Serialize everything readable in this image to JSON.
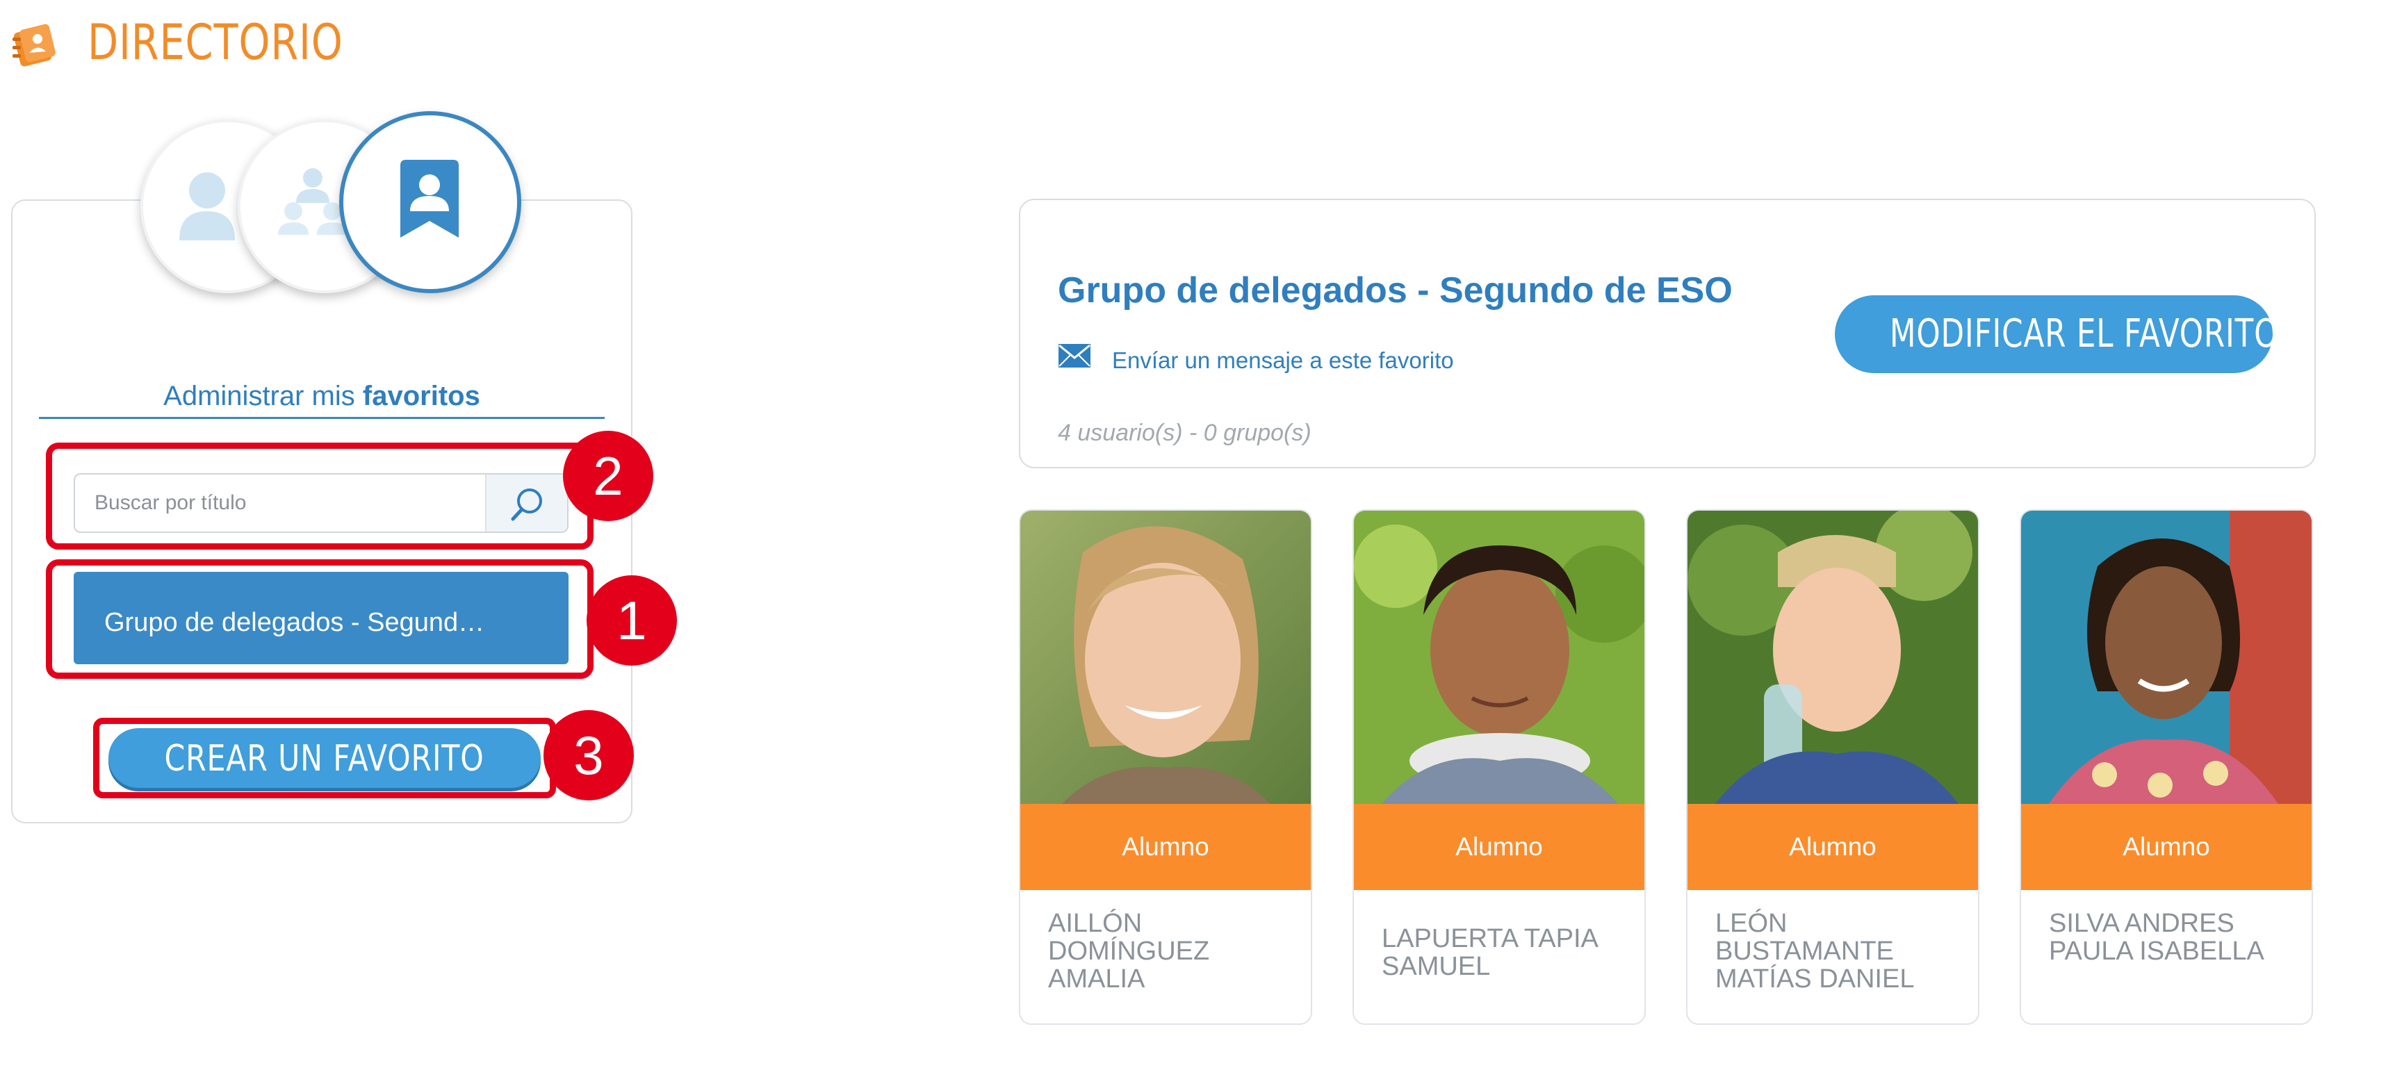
{
  "header": {
    "title": "DIRECTORIO",
    "logo_icon": "directory-book-icon"
  },
  "left_panel": {
    "modes": [
      {
        "name": "users",
        "icon": "user-icon",
        "active": false
      },
      {
        "name": "groups",
        "icon": "group-icon",
        "active": false
      },
      {
        "name": "favorites",
        "icon": "bookmark-user-icon",
        "active": true
      }
    ],
    "manage_title_prefix": "Administrar mis",
    "manage_title_bold": "favoritos",
    "search": {
      "placeholder": "Buscar por título",
      "value": "",
      "icon": "search-icon"
    },
    "favorite_items": [
      {
        "label": "Grupo de delegados - Segund…"
      }
    ],
    "create_button_label": "CREAR UN FAVORITO"
  },
  "annotations": [
    {
      "number": "2"
    },
    {
      "number": "1"
    },
    {
      "number": "3"
    }
  ],
  "favorite_detail": {
    "title": "Grupo de delegados - Segundo de ESO",
    "send_message_label": "Envíar un mensaje a este favorito",
    "mail_icon": "envelope-icon",
    "count_text": "4 usuario(s) - 0 grupo(s)",
    "modify_button_label": "MODIFICAR EL FAVORITO"
  },
  "members": [
    {
      "role": "Alumno",
      "name": "AILLÓN DOMÍNGUEZ AMALIA"
    },
    {
      "role": "Alumno",
      "name": "LAPUERTA TAPIA SAMUEL"
    },
    {
      "role": "Alumno",
      "name": "LEÓN BUSTAMANTE MATÍAS DANIEL"
    },
    {
      "role": "Alumno",
      "name": "SILVA ANDRES PAULA ISABELLA"
    }
  ],
  "colors": {
    "brand_orange": "#f28c28",
    "role_orange": "#fb8c2b",
    "primary_blue": "#3a8ac7",
    "annotation_red": "#e3001b"
  }
}
